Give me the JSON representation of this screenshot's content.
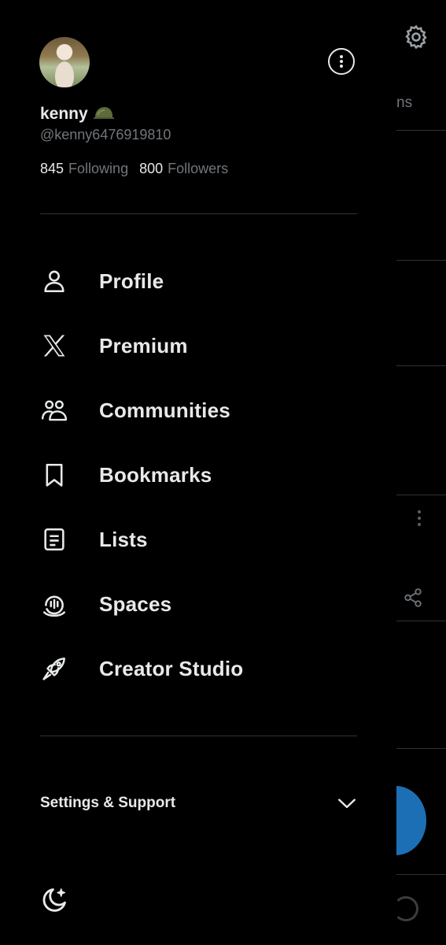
{
  "background": {
    "tab_fragment": "ns",
    "accent_color": "#1d6fb5"
  },
  "profile": {
    "name": "kenny",
    "name_emoji": "military-helmet-icon",
    "handle": "@kenny6476919810",
    "following_count": "845",
    "following_label": "Following",
    "followers_count": "800",
    "followers_label": "Followers"
  },
  "nav": {
    "items": [
      {
        "label": "Profile",
        "icon": "person-icon"
      },
      {
        "label": "Premium",
        "icon": "x-logo-icon"
      },
      {
        "label": "Communities",
        "icon": "communities-icon"
      },
      {
        "label": "Bookmarks",
        "icon": "bookmark-icon"
      },
      {
        "label": "Lists",
        "icon": "list-icon"
      },
      {
        "label": "Spaces",
        "icon": "spaces-icon"
      },
      {
        "label": "Creator Studio",
        "icon": "rocket-icon"
      }
    ]
  },
  "settings": {
    "label": "Settings & Support"
  },
  "colors": {
    "text": "#e7e9ea",
    "secondary": "#71767b",
    "divider": "#2f3336",
    "background": "#000000"
  }
}
